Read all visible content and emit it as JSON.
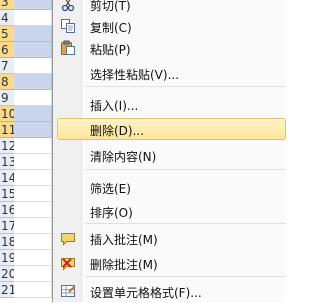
{
  "spreadsheet": {
    "rows": [
      {
        "number": "3",
        "selected": true
      },
      {
        "number": "4",
        "selected": false
      },
      {
        "number": "5",
        "selected": true
      },
      {
        "number": "6",
        "selected": true
      },
      {
        "number": "7",
        "selected": false
      },
      {
        "number": "8",
        "selected": true
      },
      {
        "number": "9",
        "selected": false
      },
      {
        "number": "10",
        "selected": true
      },
      {
        "number": "11",
        "selected": true
      },
      {
        "number": "12",
        "selected": false
      },
      {
        "number": "13",
        "selected": false
      },
      {
        "number": "14",
        "selected": false
      },
      {
        "number": "15",
        "selected": false
      },
      {
        "number": "16",
        "selected": false
      },
      {
        "number": "17",
        "selected": false
      },
      {
        "number": "18",
        "selected": false
      },
      {
        "number": "19",
        "selected": false
      },
      {
        "number": "20",
        "selected": false
      },
      {
        "number": "21",
        "selected": false
      }
    ]
  },
  "context_menu": {
    "items": [
      {
        "label": "剪切(T)",
        "icon": "scissors-icon"
      },
      {
        "label": "复制(C)",
        "icon": "copy-icon"
      },
      {
        "label": "粘贴(P)",
        "icon": "paste-icon"
      },
      {
        "label": "选择性粘贴(V)...",
        "icon": ""
      },
      {
        "label": "插入(I)...",
        "icon": ""
      },
      {
        "label": "删除(D)...",
        "icon": "",
        "highlighted": true
      },
      {
        "label": "清除内容(N)",
        "icon": ""
      },
      {
        "label": "筛选(E)",
        "icon": ""
      },
      {
        "label": "排序(O)",
        "icon": ""
      },
      {
        "label": "插入批注(M)",
        "icon": "insert-comment-icon"
      },
      {
        "label": "删除批注(M)",
        "icon": "delete-comment-icon"
      },
      {
        "label": "设置单元格格式(F)...",
        "icon": "format-cells-icon"
      }
    ],
    "hover_color": "#fde69b"
  }
}
